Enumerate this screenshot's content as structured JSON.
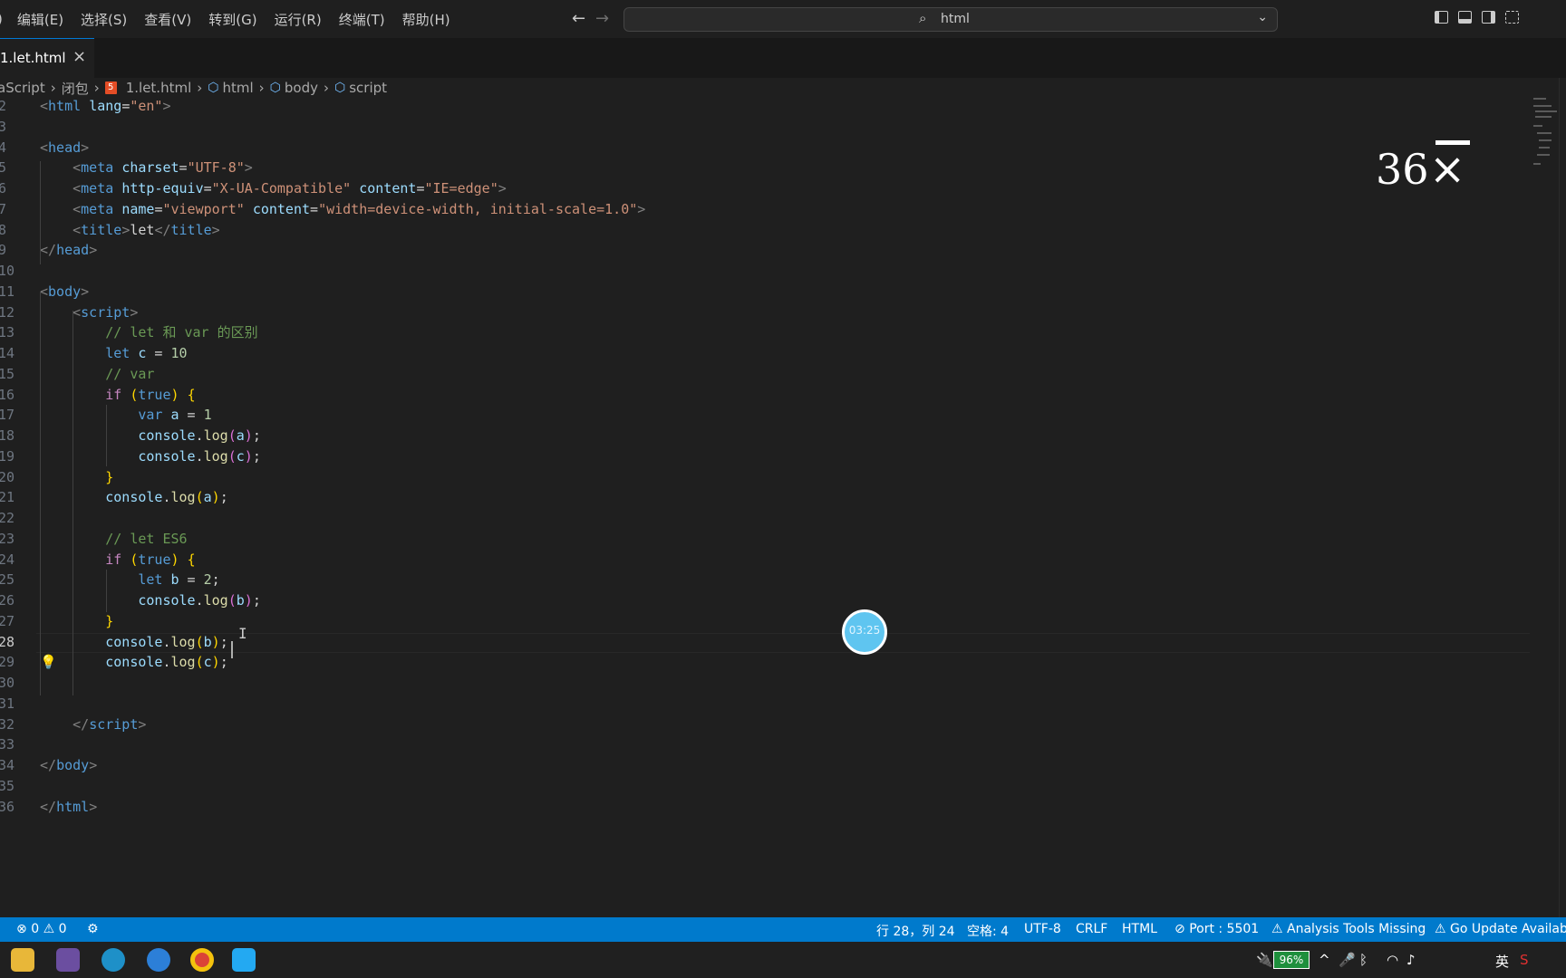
{
  "menu": [
    "编辑(E)",
    "选择(S)",
    "查看(V)",
    "转到(G)",
    "运行(R)",
    "终端(T)",
    "帮助(H)"
  ],
  "menu_partial": ")",
  "search": {
    "text": "html"
  },
  "tab": {
    "label": "1.let.html",
    "close": "×"
  },
  "breadcrumb": {
    "items": [
      "aScript",
      "闭包",
      "1.let.html",
      "html",
      "body",
      "script"
    ]
  },
  "editor": {
    "lines": [
      {
        "num": "2",
        "code": [
          [
            "tg",
            "<"
          ],
          [
            "tn",
            "html"
          ],
          [
            "pl",
            " "
          ],
          [
            "at",
            "lang"
          ],
          [
            "pl",
            "="
          ],
          [
            "st",
            "\"en\""
          ],
          [
            "tg",
            ">"
          ]
        ]
      },
      {
        "num": "3",
        "code": []
      },
      {
        "num": "4",
        "code": [
          [
            "tg",
            "<"
          ],
          [
            "tn",
            "head"
          ],
          [
            "tg",
            ">"
          ]
        ]
      },
      {
        "num": "5",
        "code": [
          [
            "pl",
            "    "
          ],
          [
            "tg",
            "<"
          ],
          [
            "tn",
            "meta"
          ],
          [
            "pl",
            " "
          ],
          [
            "at",
            "charset"
          ],
          [
            "pl",
            "="
          ],
          [
            "st",
            "\"UTF-8\""
          ],
          [
            "tg",
            ">"
          ]
        ]
      },
      {
        "num": "6",
        "code": [
          [
            "pl",
            "    "
          ],
          [
            "tg",
            "<"
          ],
          [
            "tn",
            "meta"
          ],
          [
            "pl",
            " "
          ],
          [
            "at",
            "http-equiv"
          ],
          [
            "pl",
            "="
          ],
          [
            "st",
            "\"X-UA-Compatible\""
          ],
          [
            "pl",
            " "
          ],
          [
            "at",
            "content"
          ],
          [
            "pl",
            "="
          ],
          [
            "st",
            "\"IE=edge\""
          ],
          [
            "tg",
            ">"
          ]
        ]
      },
      {
        "num": "7",
        "code": [
          [
            "pl",
            "    "
          ],
          [
            "tg",
            "<"
          ],
          [
            "tn",
            "meta"
          ],
          [
            "pl",
            " "
          ],
          [
            "at",
            "name"
          ],
          [
            "pl",
            "="
          ],
          [
            "st",
            "\"viewport\""
          ],
          [
            "pl",
            " "
          ],
          [
            "at",
            "content"
          ],
          [
            "pl",
            "="
          ],
          [
            "st",
            "\"width=device-width, initial-scale=1.0\""
          ],
          [
            "tg",
            ">"
          ]
        ]
      },
      {
        "num": "8",
        "code": [
          [
            "pl",
            "    "
          ],
          [
            "tg",
            "<"
          ],
          [
            "tn",
            "title"
          ],
          [
            "tg",
            ">"
          ],
          [
            "pl",
            "let"
          ],
          [
            "tg",
            "</"
          ],
          [
            "tn",
            "title"
          ],
          [
            "tg",
            ">"
          ]
        ]
      },
      {
        "num": "9",
        "code": [
          [
            "tg",
            "</"
          ],
          [
            "tn",
            "head"
          ],
          [
            "tg",
            ">"
          ]
        ]
      },
      {
        "num": "10",
        "code": []
      },
      {
        "num": "11",
        "code": [
          [
            "tg",
            "<"
          ],
          [
            "tn",
            "body"
          ],
          [
            "tg",
            ">"
          ]
        ]
      },
      {
        "num": "12",
        "code": [
          [
            "pl",
            "    "
          ],
          [
            "tg",
            "<"
          ],
          [
            "tn",
            "script"
          ],
          [
            "tg",
            ">"
          ]
        ]
      },
      {
        "num": "13",
        "code": [
          [
            "pl",
            "        "
          ],
          [
            "cm",
            "// let 和 var 的区别"
          ]
        ]
      },
      {
        "num": "14",
        "code": [
          [
            "pl",
            "        "
          ],
          [
            "kw",
            "let"
          ],
          [
            "pl",
            " "
          ],
          [
            "vr",
            "c"
          ],
          [
            "pl",
            " = "
          ],
          [
            "nm",
            "10"
          ]
        ]
      },
      {
        "num": "15",
        "code": [
          [
            "pl",
            "        "
          ],
          [
            "cm",
            "// var"
          ]
        ]
      },
      {
        "num": "16",
        "code": [
          [
            "pl",
            "        "
          ],
          [
            "ctl",
            "if"
          ],
          [
            "pl",
            " "
          ],
          [
            "br1",
            "("
          ],
          [
            "kw",
            "true"
          ],
          [
            "br1",
            ")"
          ],
          [
            "pl",
            " "
          ],
          [
            "br1",
            "{"
          ]
        ]
      },
      {
        "num": "17",
        "code": [
          [
            "pl",
            "            "
          ],
          [
            "kw",
            "var"
          ],
          [
            "pl",
            " "
          ],
          [
            "vr",
            "a"
          ],
          [
            "pl",
            " = "
          ],
          [
            "nm",
            "1"
          ]
        ]
      },
      {
        "num": "18",
        "code": [
          [
            "pl",
            "            "
          ],
          [
            "vr",
            "console"
          ],
          [
            "pl",
            "."
          ],
          [
            "fn",
            "log"
          ],
          [
            "br2",
            "("
          ],
          [
            "vr",
            "a"
          ],
          [
            "br2",
            ")"
          ],
          [
            "pl",
            ";"
          ]
        ]
      },
      {
        "num": "19",
        "code": [
          [
            "pl",
            "            "
          ],
          [
            "vr",
            "console"
          ],
          [
            "pl",
            "."
          ],
          [
            "fn",
            "log"
          ],
          [
            "br2",
            "("
          ],
          [
            "vr",
            "c"
          ],
          [
            "br2",
            ")"
          ],
          [
            "pl",
            ";"
          ]
        ]
      },
      {
        "num": "20",
        "code": [
          [
            "pl",
            "        "
          ],
          [
            "br1",
            "}"
          ]
        ]
      },
      {
        "num": "21",
        "code": [
          [
            "pl",
            "        "
          ],
          [
            "vr",
            "console"
          ],
          [
            "pl",
            "."
          ],
          [
            "fn",
            "log"
          ],
          [
            "br1",
            "("
          ],
          [
            "vr",
            "a"
          ],
          [
            "br1",
            ")"
          ],
          [
            "pl",
            ";"
          ]
        ]
      },
      {
        "num": "22",
        "code": []
      },
      {
        "num": "23",
        "code": [
          [
            "pl",
            "        "
          ],
          [
            "cm",
            "// let ES6"
          ]
        ]
      },
      {
        "num": "24",
        "code": [
          [
            "pl",
            "        "
          ],
          [
            "ctl",
            "if"
          ],
          [
            "pl",
            " "
          ],
          [
            "br1",
            "("
          ],
          [
            "kw",
            "true"
          ],
          [
            "br1",
            ")"
          ],
          [
            "pl",
            " "
          ],
          [
            "br1",
            "{"
          ]
        ]
      },
      {
        "num": "25",
        "code": [
          [
            "pl",
            "            "
          ],
          [
            "kw",
            "let"
          ],
          [
            "pl",
            " "
          ],
          [
            "vr",
            "b"
          ],
          [
            "pl",
            " = "
          ],
          [
            "nm",
            "2"
          ],
          [
            "pl",
            ";"
          ]
        ]
      },
      {
        "num": "26",
        "code": [
          [
            "pl",
            "            "
          ],
          [
            "vr",
            "console"
          ],
          [
            "pl",
            "."
          ],
          [
            "fn",
            "log"
          ],
          [
            "br2",
            "("
          ],
          [
            "vr",
            "b"
          ],
          [
            "br2",
            ")"
          ],
          [
            "pl",
            ";"
          ]
        ]
      },
      {
        "num": "27",
        "code": [
          [
            "pl",
            "        "
          ],
          [
            "br1",
            "}"
          ]
        ]
      },
      {
        "num": "28",
        "code": [
          [
            "pl",
            "        "
          ],
          [
            "vr",
            "console"
          ],
          [
            "pl",
            "."
          ],
          [
            "fn",
            "log"
          ],
          [
            "br1",
            "("
          ],
          [
            "vr",
            "b"
          ],
          [
            "br1",
            ")"
          ],
          [
            "pl",
            ";"
          ]
        ]
      },
      {
        "num": "29",
        "code": [
          [
            "pl",
            "        "
          ],
          [
            "vr",
            "console"
          ],
          [
            "pl",
            "."
          ],
          [
            "fn",
            "log"
          ],
          [
            "br1",
            "("
          ],
          [
            "vr",
            "c"
          ],
          [
            "br1",
            ")"
          ],
          [
            "pl",
            ";"
          ]
        ]
      },
      {
        "num": "30",
        "code": []
      },
      {
        "num": "31",
        "code": []
      },
      {
        "num": "32",
        "code": [
          [
            "pl",
            "    "
          ],
          [
            "tg",
            "</"
          ],
          [
            "tn",
            "script"
          ],
          [
            "tg",
            ">"
          ]
        ]
      },
      {
        "num": "33",
        "code": []
      },
      {
        "num": "34",
        "code": [
          [
            "tg",
            "</"
          ],
          [
            "tn",
            "body"
          ],
          [
            "tg",
            ">"
          ]
        ]
      },
      {
        "num": "35",
        "code": []
      },
      {
        "num": "36",
        "code": [
          [
            "tg",
            "</"
          ],
          [
            "tn",
            "html"
          ],
          [
            "tg",
            ">"
          ]
        ]
      }
    ],
    "active_line": "28"
  },
  "overlay": {
    "zoom_value": "36",
    "timer": "03:25"
  },
  "status": {
    "errors": "0",
    "warnings": "0",
    "position": "行 28，列 24",
    "spaces": "空格: 4",
    "encoding": "UTF-8",
    "eol": "CRLF",
    "language": "HTML",
    "port": "Port : 5501",
    "analysis": "Analysis Tools Missing",
    "go_update": "Go Update Available"
  },
  "taskbar": {
    "battery": "96%",
    "ime": "英"
  },
  "colors": {
    "statusbar": "#007acc",
    "editor_bg": "#1f1f1f",
    "accent": "#0078d4"
  }
}
